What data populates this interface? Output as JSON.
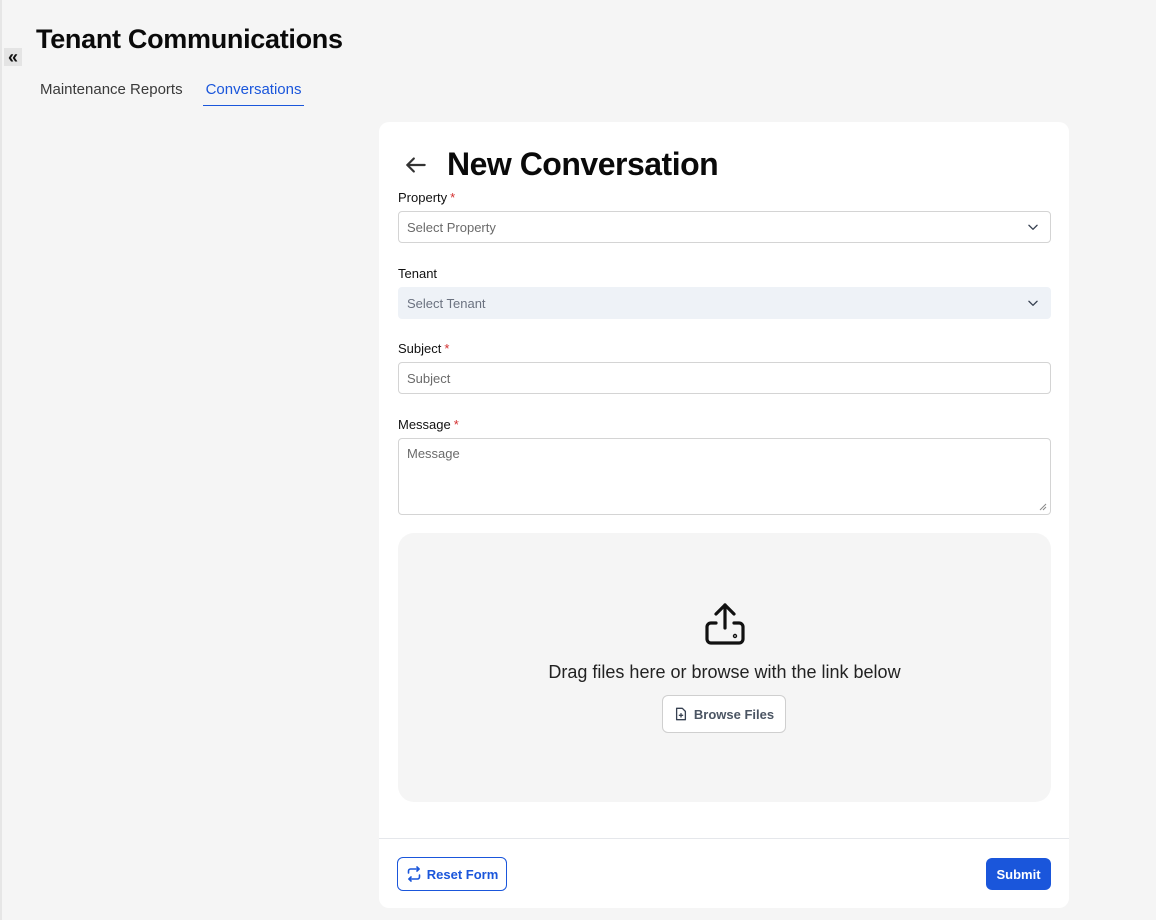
{
  "header": {
    "collapse_icon": "double-chevron-left-icon",
    "collapse_glyph": "«",
    "title": "Tenant Communications"
  },
  "tabs": [
    {
      "label": "Maintenance Reports",
      "active": false
    },
    {
      "label": "Conversations",
      "active": true
    }
  ],
  "form": {
    "back_icon": "arrow-left-icon",
    "title": "New Conversation",
    "property": {
      "label": "Property",
      "required": "*",
      "placeholder": "Select Property"
    },
    "tenant": {
      "label": "Tenant",
      "placeholder": "Select Tenant"
    },
    "subject": {
      "label": "Subject",
      "required": "*",
      "placeholder": "Subject"
    },
    "message": {
      "label": "Message",
      "required": "*",
      "placeholder": "Message"
    },
    "dropzone": {
      "icon": "upload-icon",
      "text": "Drag files here or browse with the link below",
      "browse_label": "Browse Files",
      "browse_icon": "file-plus-icon"
    },
    "reset_label": "Reset Form",
    "reset_icon": "refresh-icon",
    "submit_label": "Submit"
  },
  "colors": {
    "accent": "#1a56db",
    "required": "#d32f2f",
    "page_bg": "#f5f5f5",
    "disabled_field_bg": "#eef2f7"
  }
}
